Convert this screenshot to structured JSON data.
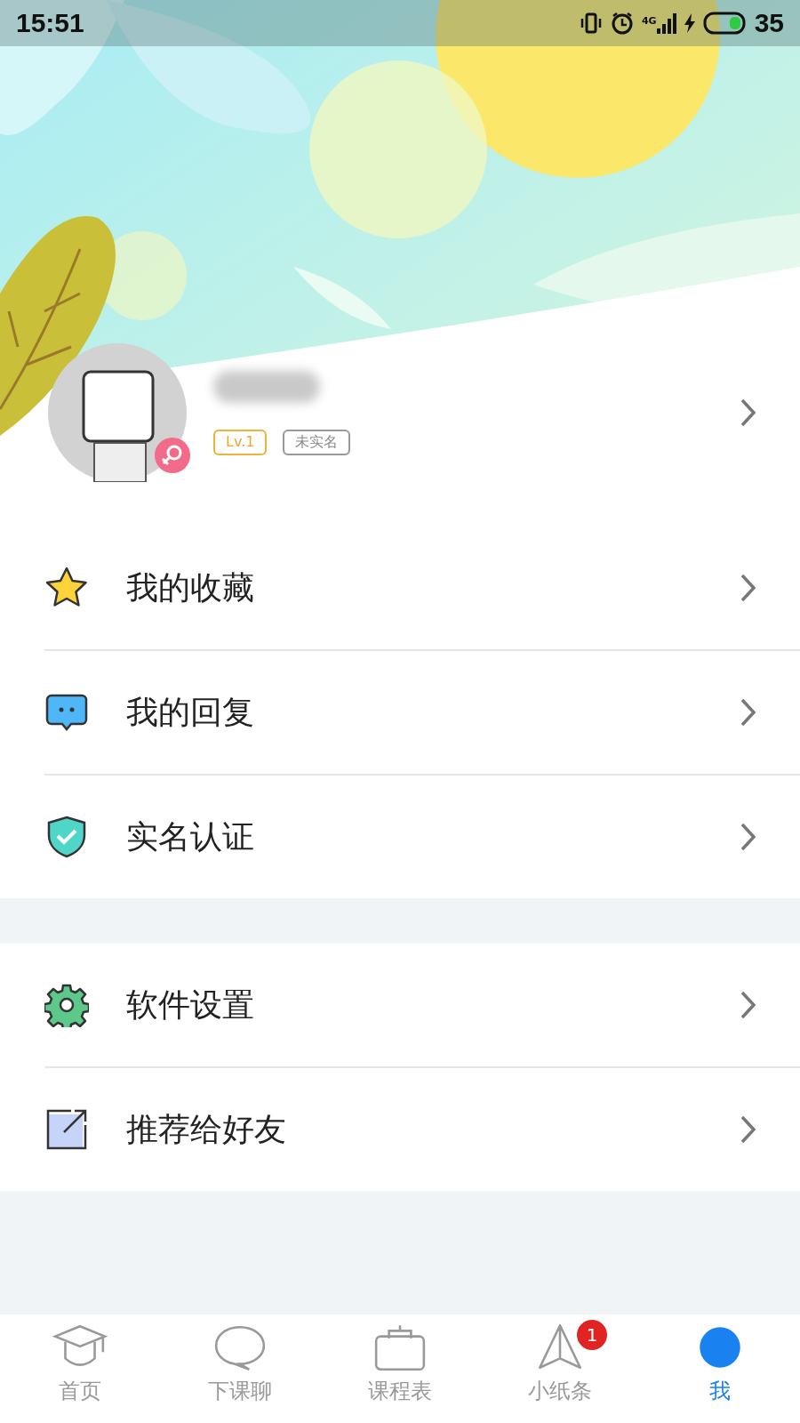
{
  "status_bar": {
    "time": "15:51",
    "network": "4G",
    "battery": "35"
  },
  "profile": {
    "level_tag": "Lv.1",
    "verify_tag": "未实名"
  },
  "menu_groups": [
    {
      "items": [
        {
          "kind": "star",
          "label": "我的收藏"
        },
        {
          "kind": "chat",
          "label": "我的回复"
        },
        {
          "kind": "shield",
          "label": "实名认证"
        }
      ]
    },
    {
      "items": [
        {
          "kind": "gear",
          "label": "软件设置"
        },
        {
          "kind": "share",
          "label": "推荐给好友"
        }
      ]
    }
  ],
  "tab_bar": [
    {
      "kind": "home",
      "label": "首页",
      "selected": false
    },
    {
      "kind": "chat",
      "label": "下课聊",
      "selected": false
    },
    {
      "kind": "clipboard",
      "label": "课程表",
      "selected": false
    },
    {
      "kind": "plane",
      "label": "小纸条",
      "selected": false,
      "badge": "1"
    },
    {
      "kind": "me",
      "label": "我",
      "selected": true
    }
  ]
}
